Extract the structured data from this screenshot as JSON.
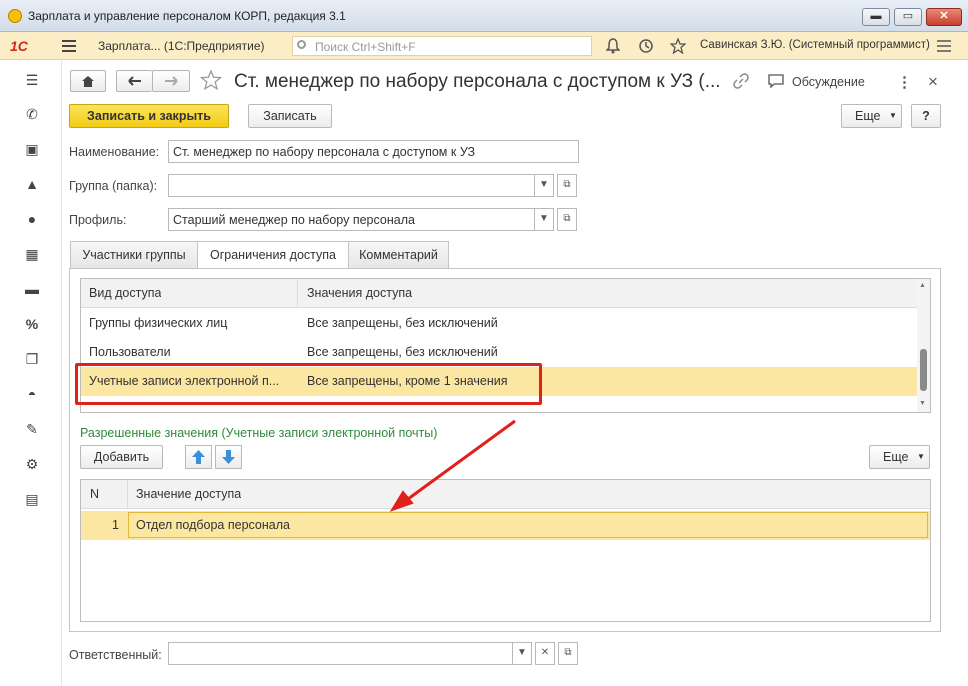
{
  "window": {
    "title": "Зарплата и управление персоналом КОРП, редакция 3.1",
    "minimize": "▬",
    "maximize": "▭",
    "close": "✕"
  },
  "appbar": {
    "logo": "1С",
    "app_title": "Зарплата... (1С:Предприятие)",
    "search_placeholder": "Поиск Ctrl+Shift+F",
    "user": "Савинская З.Ю. (Системный программист)"
  },
  "form": {
    "title": "Ст. менеджер по набору персонала с доступом к УЗ (...",
    "discussion": "Обсуждение",
    "more_menu": "⋮",
    "close": "×",
    "save_close": "Записать и закрыть",
    "save": "Записать",
    "more": "Еще",
    "help": "?",
    "name_label": "Наименование:",
    "name_value": "Ст. менеджер по набору персонала с доступом к УЗ",
    "group_label": "Группа (папка):",
    "group_value": "",
    "profile_label": "Профиль:",
    "profile_value": "Старший менеджер по набору персонала",
    "responsible_label": "Ответственный:",
    "responsible_value": ""
  },
  "tabs": [
    {
      "label": "Участники группы"
    },
    {
      "label": "Ограничения доступа"
    },
    {
      "label": "Комментарий"
    }
  ],
  "access_table": {
    "headers": [
      "Вид доступа",
      "Значения доступа"
    ],
    "rows": [
      {
        "kind": "Группы физических лиц",
        "value": "Все запрещены, без исключений"
      },
      {
        "kind": "Пользователи",
        "value": "Все запрещены, без исключений"
      },
      {
        "kind": "Учетные записи электронной п...",
        "value": "Все запрещены, кроме 1 значения"
      }
    ]
  },
  "allowed": {
    "title": "Разрешенные значения (Учетные записи электронной почты)",
    "add": "Добавить",
    "more": "Еще",
    "headers": [
      "N",
      "Значение доступа"
    ],
    "rows": [
      {
        "n": "1",
        "value": "Отдел подбора персонала"
      }
    ]
  },
  "colors": {
    "accent_yellow": "#f2cc14",
    "highlight_red": "#e0201a",
    "selected_row": "#fbe6a2",
    "section_green": "#2e8b3a"
  }
}
